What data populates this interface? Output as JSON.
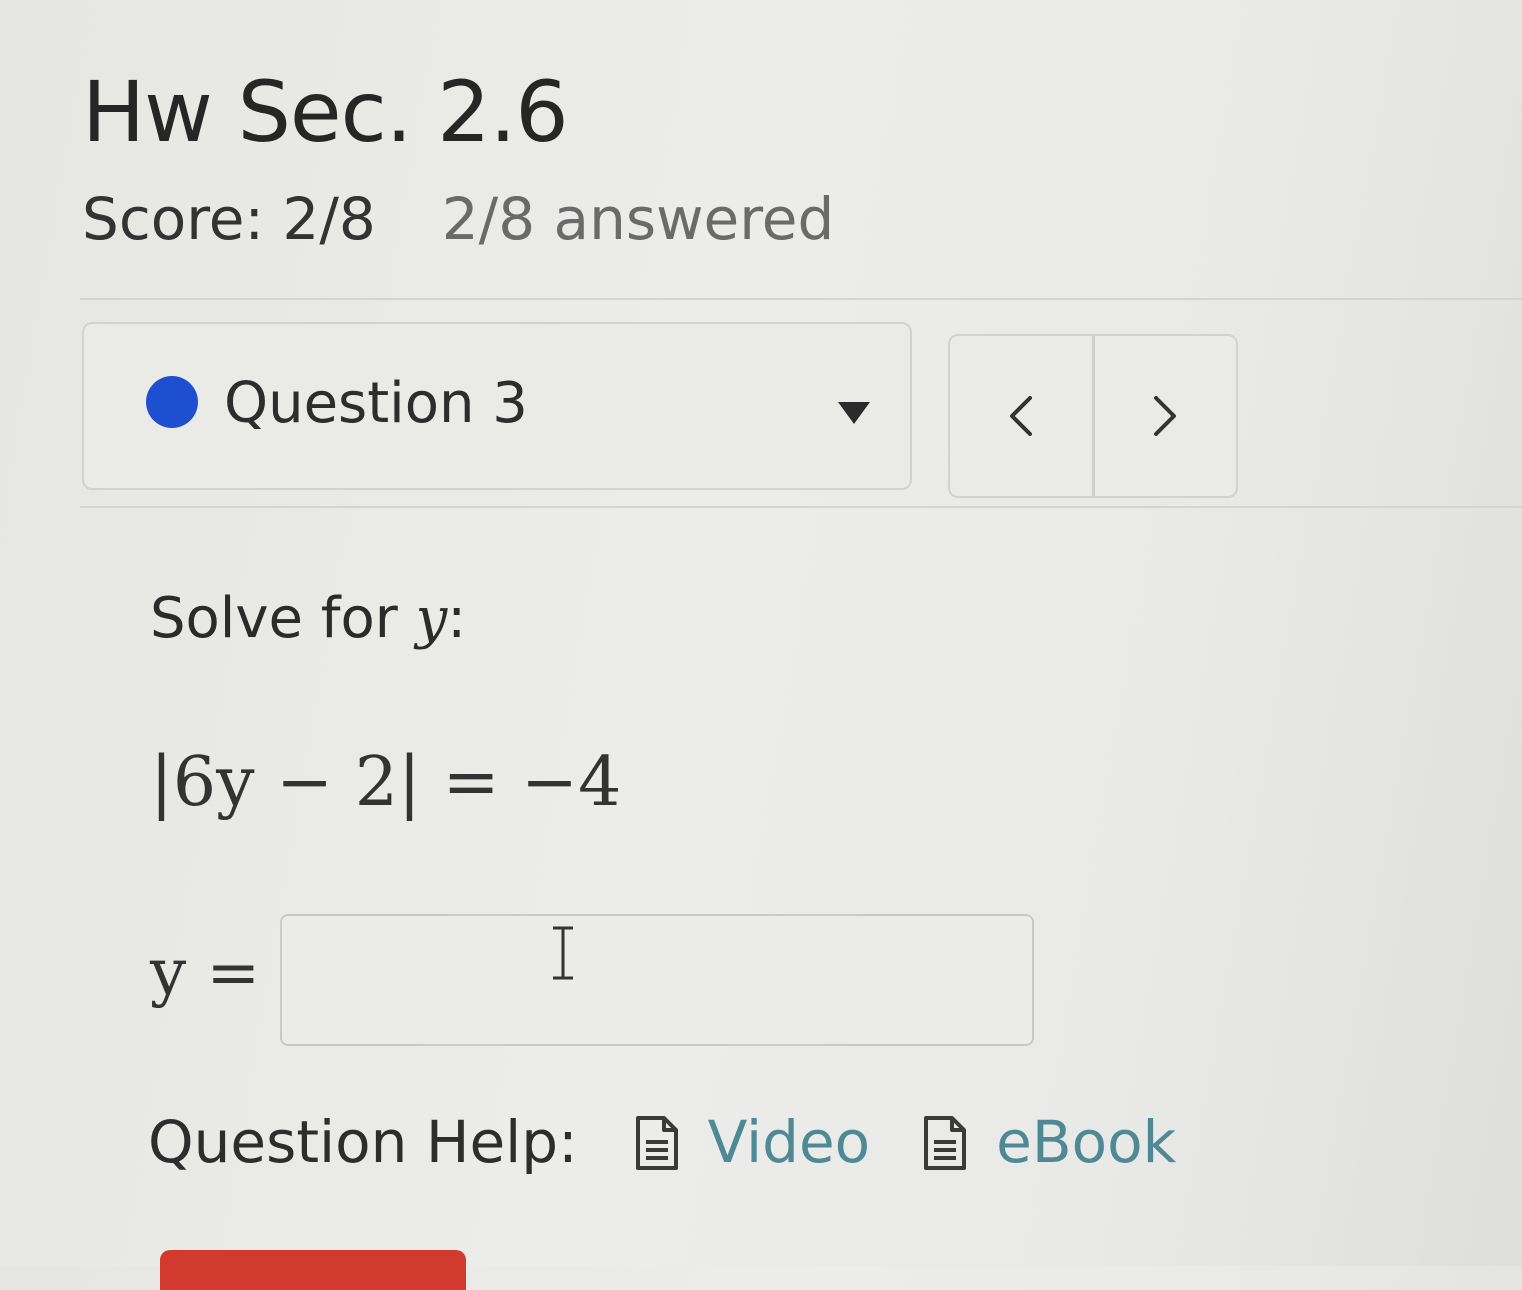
{
  "header": {
    "title": "Hw Sec. 2.6",
    "score": "Score: 2/8",
    "answered": "2/8 answered"
  },
  "question_nav": {
    "selected_label": "Question 3",
    "status_color": "#1f4fd1",
    "dropdown_icon": "caret-down-icon",
    "prev_icon": "chevron-left-icon",
    "next_icon": "chevron-right-icon"
  },
  "problem": {
    "prompt_text": "Solve for ",
    "prompt_var": "y",
    "prompt_suffix": ":",
    "equation": "|6y − 2| = −4",
    "answer_label": "y ="
  },
  "answer_input": {
    "value": ""
  },
  "help": {
    "label": "Question Help:",
    "links": [
      {
        "label": "Video",
        "icon": "document-icon"
      },
      {
        "label": "eBook",
        "icon": "document-icon"
      }
    ],
    "link_color": "#4f8996"
  },
  "submit": {
    "color": "#d33a2e"
  }
}
